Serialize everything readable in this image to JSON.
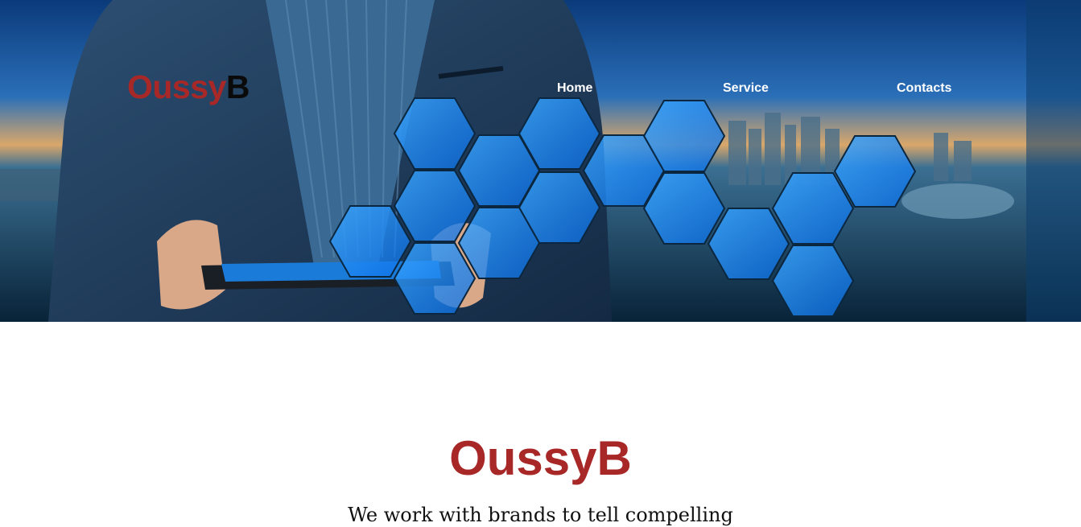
{
  "brand": {
    "logo_part1": "Oussy",
    "logo_part2": "B",
    "color_primary": "#a82828",
    "color_secondary": "#0a0a0a"
  },
  "nav": {
    "items": [
      {
        "label": "Home"
      },
      {
        "label": "Service"
      },
      {
        "label": "Contacts"
      }
    ]
  },
  "hero": {
    "image_subject": "businessman-holding-tablet-with-hexagon-network-over-city-skyline",
    "accent_color": "#1e8fff"
  },
  "intro": {
    "title": "OussyB",
    "text": "We work with brands to tell compelling"
  }
}
